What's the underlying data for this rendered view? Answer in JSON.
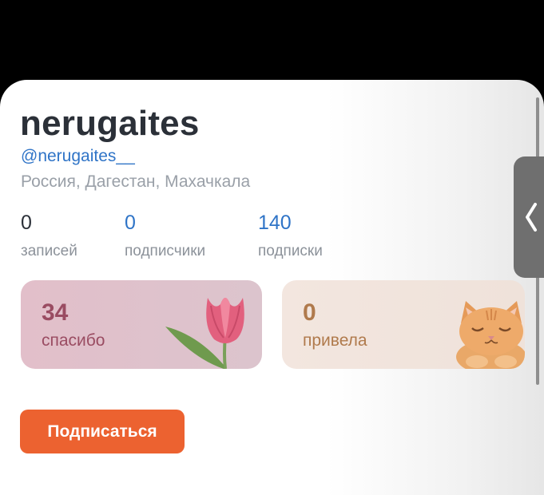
{
  "profile": {
    "name": "nerugaites",
    "handle": "@nerugaites__",
    "location": "Россия, Дагестан, Махачкала"
  },
  "stats": [
    {
      "value": "0",
      "label": "записей"
    },
    {
      "value": "0",
      "label": "подписчики"
    },
    {
      "value": "140",
      "label": "подписки"
    }
  ],
  "tiles": [
    {
      "value": "34",
      "label": "спасибо",
      "icon": "tulip-icon"
    },
    {
      "value": "0",
      "label": "привела",
      "icon": "kitten-icon"
    }
  ],
  "actions": {
    "subscribe_label": "Подписаться"
  },
  "colors": {
    "accent": "#ec6230",
    "link": "#2f74c7",
    "text": "#2b3038",
    "muted": "#9aa0a8"
  }
}
